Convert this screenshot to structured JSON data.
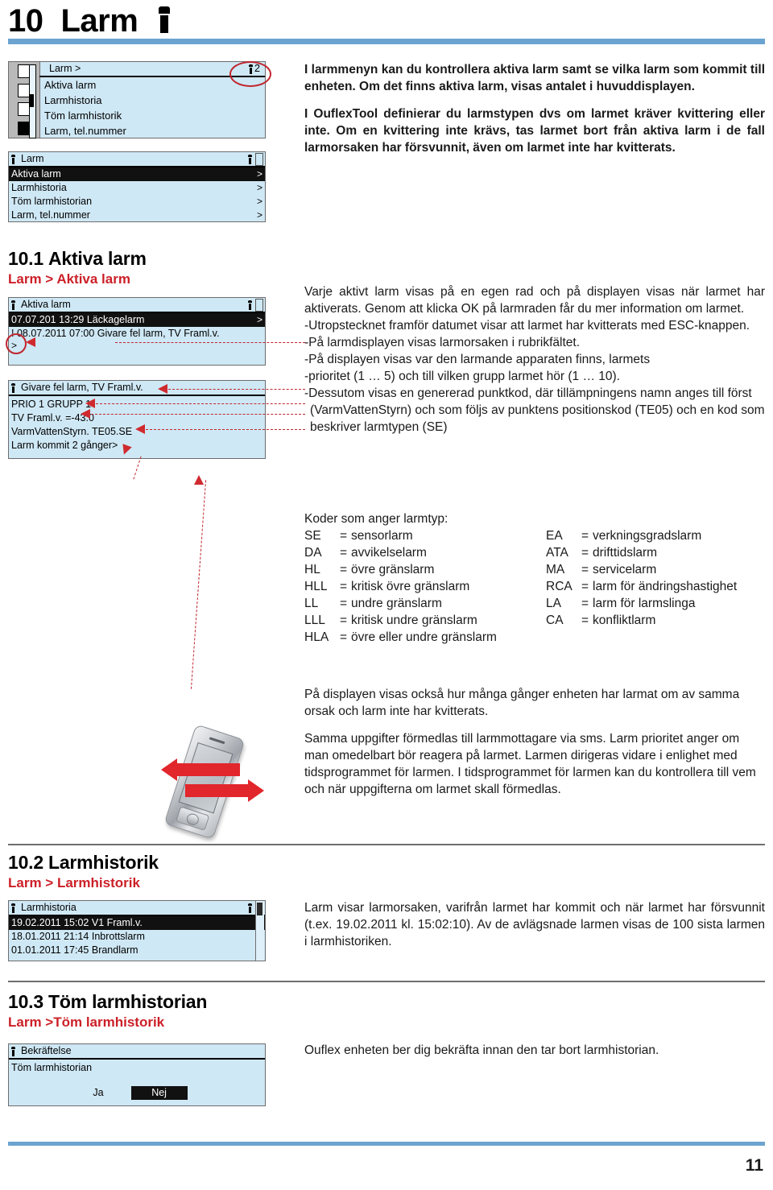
{
  "document": {
    "chapter_number": "10",
    "chapter_title": "Larm",
    "page_number": "11",
    "accent_blue": "#6ba4d0",
    "accent_red": "#cc2028",
    "lcd_background": "#cfe8f5"
  },
  "intro": {
    "paragraph_1": "I larmmenyn kan du kontrollera aktiva larm samt se vilka larm som kommit till enheten. Om det finns aktiva larm, visas antalet i huvuddisplayen.",
    "paragraph_2": "I OuflexTool definierar du larmstypen dvs om larmet kräver kvittering eller inte. Om en kvittering inte krävs, tas larmet bort från aktiva larm i de fall larmorsaken har försvunnit, även om larmet inte har kvitterats."
  },
  "lcd_main_menu": {
    "title": "Larm >",
    "alarm_count": "2",
    "items": [
      "Aktiva larm",
      "Larmhistoria",
      "Töm larmhistorik",
      "Larm, tel.nummer"
    ]
  },
  "lcd_larm_menu": {
    "title": "Larm",
    "rows": [
      {
        "label": "Aktiva larm",
        "chevron": ">",
        "selected": true
      },
      {
        "label": "Larmhistoria",
        "chevron": ">",
        "selected": false
      },
      {
        "label": "Töm larmhistorian",
        "chevron": ">",
        "selected": false
      },
      {
        "label": "Larm, tel.nummer",
        "chevron": ">",
        "selected": false
      }
    ]
  },
  "section_10_1": {
    "heading_number": "10.1",
    "heading_title": "Aktiva larm",
    "breadcrumb": "Larm > Aktiva larm",
    "lcd_active_alarms": {
      "title": "Aktiva larm",
      "rows": [
        {
          "label": "07.07.201 13:29  Läckagelarm",
          "chevron": ">",
          "selected": true
        },
        {
          "label": "! 08.07.2011 07:00 Givare fel larm, TV Framl.v.",
          "chevron": ">",
          "selected": false
        }
      ]
    },
    "lcd_alarm_detail": {
      "title": "Givare fel larm, TV Framl.v.",
      "lines": [
        "PRIO 1 GRUPP 1",
        "TV Framl.v. =-43.0",
        "VarmVattenStyrn. TE05.SE",
        "Larm kommit 2 gånger>"
      ]
    },
    "paragraph_1": "Varje aktivt larm visas på en egen rad och på displayen visas när larmet har aktiverats. Genom att klicka OK på larmraden får du mer information om larmet.",
    "bullets": [
      "Utropstecknet framför datumet visar att larmet har kvitterats med ESC-knappen.",
      "På larmdisplayen visas larmorsaken i rubrikfältet.",
      "På displayen visas var den larmande apparaten finns, larmets",
      "prioritet (1 … 5) och till vilken grupp larmet hör (1 … 10).",
      "Dessutom visas en genererad punktkod, där tillämpningens namn anges till först (VarmVattenStyrn) och som följs av punktens positionskod (TE05) och en kod som beskriver larmtypen (SE)"
    ],
    "codes_title": "Koder som anger larmtyp:",
    "codes_left": [
      {
        "code": "SE",
        "desc": "sensorlarm"
      },
      {
        "code": "DA",
        "desc": "avvikelselarm"
      },
      {
        "code": "HL",
        "desc": "övre gränslarm"
      },
      {
        "code": "HLL",
        "desc": "kritisk övre gränslarm"
      },
      {
        "code": "LL",
        "desc": "undre gränslarm"
      },
      {
        "code": "LLL",
        "desc": "kritisk undre gränslarm"
      },
      {
        "code": "HLA",
        "desc": "övre eller undre gränslarm"
      }
    ],
    "codes_right": [
      {
        "code": "EA",
        "desc": "verkningsgradslarm"
      },
      {
        "code": "ATA",
        "desc": "drifttidslarm"
      },
      {
        "code": "MA",
        "desc": "servicelarm"
      },
      {
        "code": "RCA",
        "desc": "larm för ändringshastighet"
      },
      {
        "code": "LA",
        "desc": "larm för larmslinga"
      },
      {
        "code": "CA",
        "desc": "konfliktlarm"
      }
    ],
    "paragraph_sms_1": "På displayen visas också hur många gånger enheten har larmat om av samma orsak och larm inte har kvitterats.",
    "paragraph_sms_2": "Samma uppgifter förmedlas till larmmottagare via sms. Larm prioritet anger om man omedelbart bör reagera på larmet. Larmen dirigeras vidare i enlighet med tidsprogrammet för larmen. I tidsprogrammet för larmen kan du kontrollera till vem och när uppgifterna om larmet skall förmedlas."
  },
  "section_10_2": {
    "heading_number": "10.2",
    "heading_title": "Larmhistorik",
    "breadcrumb": "Larm > Larmhistorik",
    "lcd_history": {
      "title": "Larmhistoria",
      "rows": [
        {
          "label": "19.02.2011  15:02  V1 Framl.v.",
          "chevron": ">",
          "selected": true
        },
        {
          "label": "18.01.2011  21:14  Inbrottslarm",
          "chevron": ">",
          "selected": false
        },
        {
          "label": "01.01.2011  17:45  Brandlarm",
          "chevron": ">",
          "selected": false
        }
      ]
    },
    "paragraph": "Larm visar larmorsaken, varifrån larmet har kommit och när larmet har försvunnit (t.ex. 19.02.2011 kl. 15:02:10). Av de avlägsnade larmen visas de 100 sista larmen i larmhistoriken."
  },
  "section_10_3": {
    "heading_number": "10.3",
    "heading_title": "Töm larmhistorian",
    "breadcrumb": "Larm >Töm larmhistorik",
    "lcd_confirm": {
      "title": "Bekräftelse",
      "message": "Töm larmhistorian",
      "button_yes": "Ja",
      "button_no": "Nej"
    },
    "paragraph": "Ouflex enheten ber dig bekräfta innan den tar bort larmhistorian."
  }
}
